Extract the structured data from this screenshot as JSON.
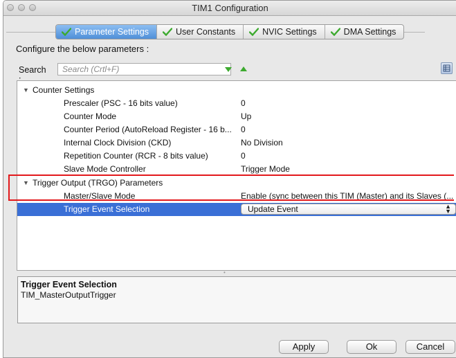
{
  "window": {
    "title": "TIM1 Configuration"
  },
  "tabs": [
    {
      "label": "Parameter Settings",
      "active": true
    },
    {
      "label": "User Constants",
      "active": false
    },
    {
      "label": "NVIC Settings",
      "active": false
    },
    {
      "label": "DMA Settings",
      "active": false
    }
  ],
  "configure_label": "Configure the below parameters :",
  "search": {
    "label": "Search :",
    "placeholder": "Search (Crtl+F)"
  },
  "groups": {
    "counter": {
      "title": "Counter Settings",
      "rows": [
        {
          "name": "Prescaler (PSC - 16 bits value)",
          "value": "0"
        },
        {
          "name": "Counter Mode",
          "value": "Up"
        },
        {
          "name": "Counter Period (AutoReload Register - 16 b...",
          "value": "0"
        },
        {
          "name": "Internal Clock Division (CKD)",
          "value": "No Division"
        },
        {
          "name": "Repetition Counter (RCR - 8 bits value)",
          "value": "0"
        },
        {
          "name": "Slave Mode Controller",
          "value": "Trigger Mode"
        }
      ]
    },
    "trgo": {
      "title": "Trigger Output (TRGO) Parameters",
      "rows": [
        {
          "name": "Master/Slave Mode",
          "value": "Enable (sync between this TIM (Master) and its Slaves (..."
        },
        {
          "name": "Trigger Event Selection",
          "value": "Update Event"
        }
      ]
    }
  },
  "description": {
    "title": "Trigger Event Selection",
    "text": "TIM_MasterOutputTrigger"
  },
  "buttons": {
    "apply": "Apply",
    "ok": "Ok",
    "cancel": "Cancel"
  },
  "colors": {
    "selection": "#3a6fd6",
    "highlight_box": "#e3181b",
    "check_green": "#3daa2f"
  }
}
